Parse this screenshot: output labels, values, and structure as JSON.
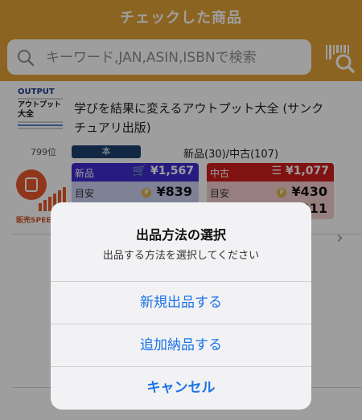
{
  "header": {
    "title": "チェックした商品",
    "color": "#e3a236"
  },
  "search": {
    "placeholder": "キーワード,JAN,ASIN,ISBNで検索",
    "icon": "search-icon",
    "scan_icon": "barcode-scan-icon"
  },
  "item": {
    "cover": {
      "line1": "OUTPUT",
      "line2": "アウトプット",
      "line3": "大全"
    },
    "rank": "799位",
    "speed_label": "販売SPEED",
    "title": "学びを結果に変えるアウトプット大全 (サンクチュアリ出版)",
    "category": "本",
    "counts": "新品(30)/中古(107)",
    "new": {
      "label": "新品",
      "price": "¥1,567",
      "guide_label": "目安",
      "guide_price": "¥839"
    },
    "used": {
      "label": "中古",
      "price": "¥1,077",
      "guide_label": "目安",
      "guide_price": "¥430",
      "guide_price2": "¥311"
    }
  },
  "sheet": {
    "title": "出品方法の選択",
    "message": "出品する方法を選択してください",
    "actions": [
      "新規出品する",
      "追加納品する"
    ],
    "cancel": "キャンセル"
  }
}
